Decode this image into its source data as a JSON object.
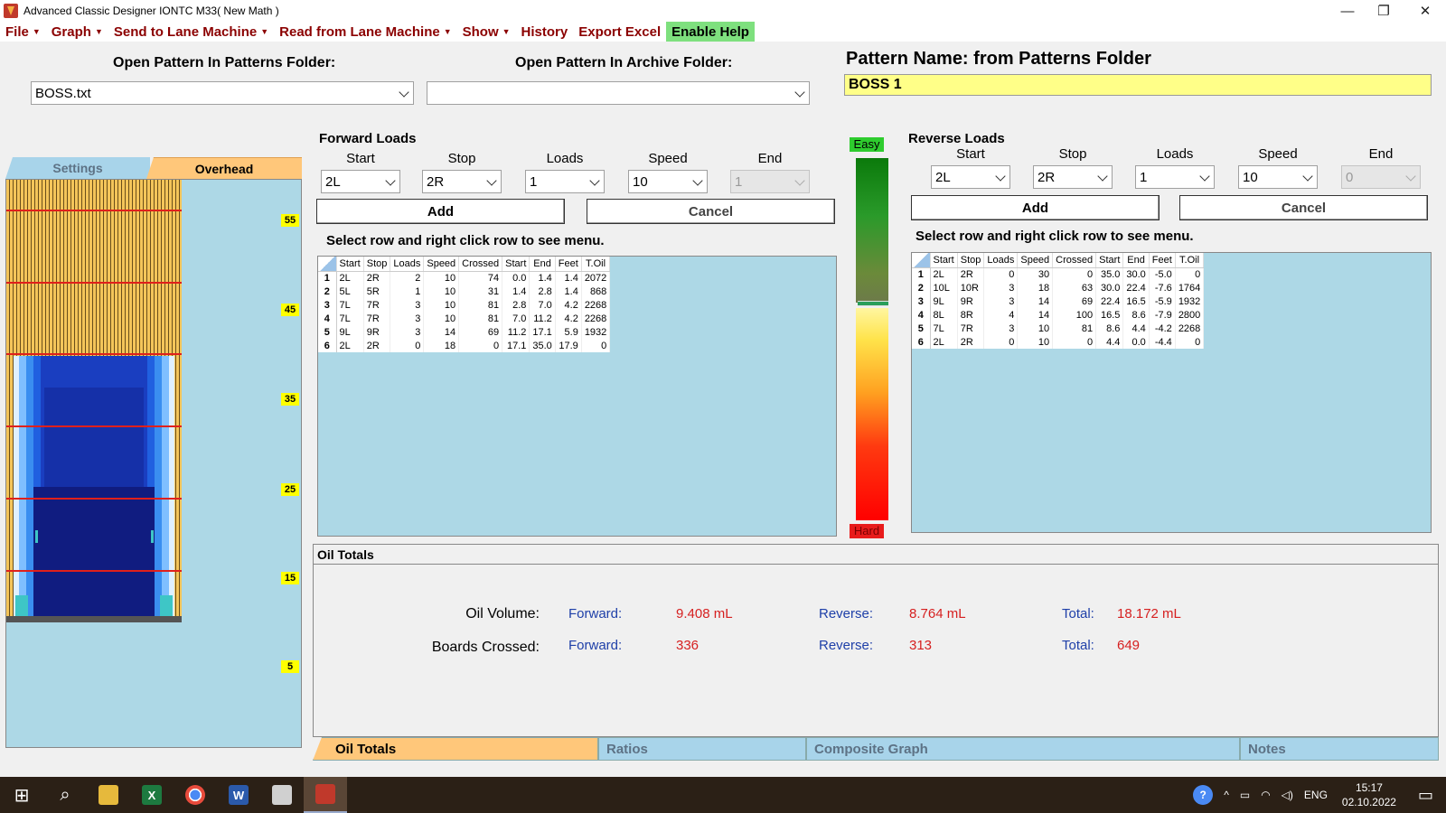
{
  "window": {
    "title": "Advanced Classic Designer IONTC M33( New Math )",
    "minimize": "—",
    "restore": "❐",
    "close": "✕"
  },
  "menu": {
    "file": "File",
    "graph": "Graph",
    "send": "Send to Lane Machine",
    "read": "Read from Lane Machine",
    "show": "Show",
    "history": "History",
    "export": "Export Excel",
    "help": "Enable Help"
  },
  "open": {
    "patterns_label": "Open Pattern In Patterns Folder:",
    "patterns_value": "BOSS.txt",
    "archive_label": "Open Pattern In Archive Folder:",
    "archive_value": ""
  },
  "pattern": {
    "name_label": "Pattern Name: from Patterns Folder",
    "name_value": "BOSS 1"
  },
  "lane_tabs": {
    "settings": "Settings",
    "overhead": "Overhead"
  },
  "lane_numbers": [
    "55",
    "45",
    "35",
    "25",
    "15",
    "5"
  ],
  "forward": {
    "title": "Forward Loads",
    "labels": {
      "start": "Start",
      "stop": "Stop",
      "loads": "Loads",
      "speed": "Speed",
      "end": "End"
    },
    "values": {
      "start": "2L",
      "stop": "2R",
      "loads": "1",
      "speed": "10",
      "end": "1"
    },
    "add": "Add",
    "cancel": "Cancel",
    "hint": "Select row and right click row to see menu.",
    "columns": [
      "Start",
      "Stop",
      "Loads",
      "Speed",
      "Crossed",
      "Start",
      "End",
      "Feet",
      "T.Oil"
    ],
    "rows": [
      [
        "1",
        "2L",
        "2R",
        "2",
        "10",
        "74",
        "0.0",
        "1.4",
        "1.4",
        "2072"
      ],
      [
        "2",
        "5L",
        "5R",
        "1",
        "10",
        "31",
        "1.4",
        "2.8",
        "1.4",
        "868"
      ],
      [
        "3",
        "7L",
        "7R",
        "3",
        "10",
        "81",
        "2.8",
        "7.0",
        "4.2",
        "2268"
      ],
      [
        "4",
        "7L",
        "7R",
        "3",
        "10",
        "81",
        "7.0",
        "11.2",
        "4.2",
        "2268"
      ],
      [
        "5",
        "9L",
        "9R",
        "3",
        "14",
        "69",
        "11.2",
        "17.1",
        "5.9",
        "1932"
      ],
      [
        "6",
        "2L",
        "2R",
        "0",
        "18",
        "0",
        "17.1",
        "35.0",
        "17.9",
        "0"
      ]
    ]
  },
  "reverse": {
    "title": "Reverse Loads",
    "labels": {
      "start": "Start",
      "stop": "Stop",
      "loads": "Loads",
      "speed": "Speed",
      "end": "End"
    },
    "values": {
      "start": "2L",
      "stop": "2R",
      "loads": "1",
      "speed": "10",
      "end": "0"
    },
    "add": "Add",
    "cancel": "Cancel",
    "hint": "Select row and right click row to see menu.",
    "columns": [
      "Start",
      "Stop",
      "Loads",
      "Speed",
      "Crossed",
      "Start",
      "End",
      "Feet",
      "T.Oil"
    ],
    "rows": [
      [
        "1",
        "2L",
        "2R",
        "0",
        "30",
        "0",
        "35.0",
        "30.0",
        "-5.0",
        "0"
      ],
      [
        "2",
        "10L",
        "10R",
        "3",
        "18",
        "63",
        "30.0",
        "22.4",
        "-7.6",
        "1764"
      ],
      [
        "3",
        "9L",
        "9R",
        "3",
        "14",
        "69",
        "22.4",
        "16.5",
        "-5.9",
        "1932"
      ],
      [
        "4",
        "8L",
        "8R",
        "4",
        "14",
        "100",
        "16.5",
        "8.6",
        "-7.9",
        "2800"
      ],
      [
        "5",
        "7L",
        "7R",
        "3",
        "10",
        "81",
        "8.6",
        "4.4",
        "-4.2",
        "2268"
      ],
      [
        "6",
        "2L",
        "2R",
        "0",
        "10",
        "0",
        "4.4",
        "0.0",
        "-4.4",
        "0"
      ]
    ]
  },
  "gauge": {
    "easy": "Easy",
    "hard": "Hard"
  },
  "oil": {
    "title": "Oil Totals",
    "volume_label": "Oil Volume:",
    "boards_label": "Boards Crossed:",
    "forward_key": "Forward:",
    "reverse_key": "Reverse:",
    "total_key": "Total:",
    "volume_forward": "9.408 mL",
    "volume_reverse": "8.764 mL",
    "volume_total": "18.172 mL",
    "boards_forward": "336",
    "boards_reverse": "313",
    "boards_total": "649"
  },
  "bottom_tabs": [
    "Oil Totals",
    "Ratios",
    "Composite Graph",
    "Notes"
  ],
  "taskbar": {
    "lang": "ENG",
    "time": "15:17",
    "date": "02.10.2022",
    "help_icon_glyph": "?",
    "chevron_glyph": "^",
    "excel_glyph": "X",
    "word_glyph": "W",
    "start_glyph": "⊞",
    "search_glyph": "⌕",
    "notify_glyph": "▭"
  },
  "colors": {
    "menu_text": "#8b0000",
    "panel_blue": "#add8e6",
    "tab_orange": "#ffc77a",
    "value_red": "#d62020",
    "key_blue": "#1e3fa8",
    "pattern_yellow": "#ffff88"
  }
}
